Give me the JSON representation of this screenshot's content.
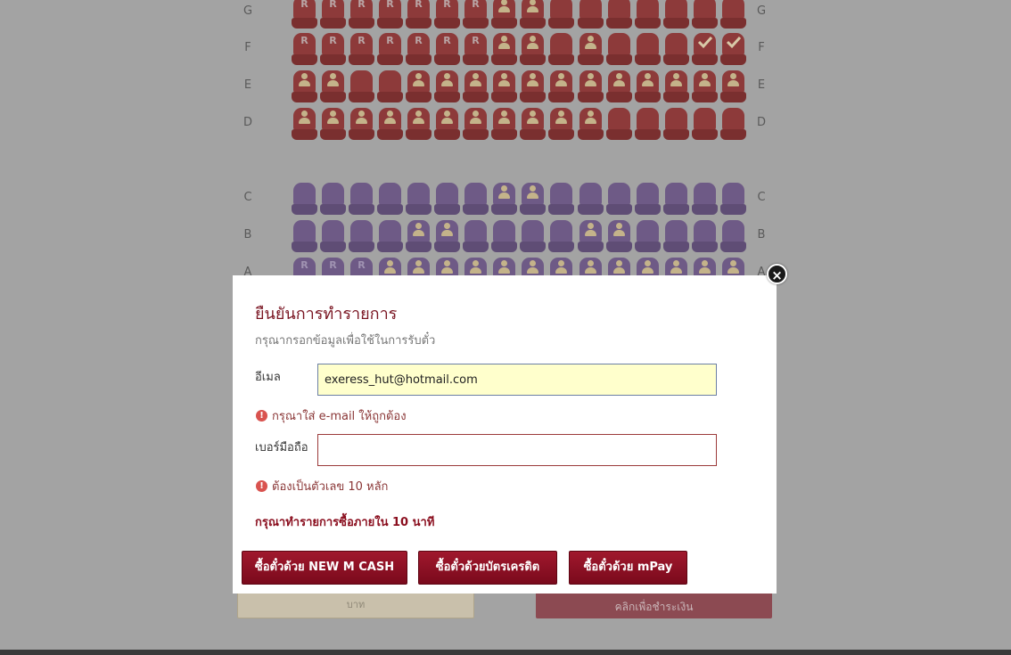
{
  "seat_map": {
    "rows_top": [
      {
        "letter": "G",
        "seats": [
          "R",
          "R",
          "R",
          "R",
          "R",
          "R",
          "R",
          "P",
          "P",
          "",
          "",
          "",
          "",
          "",
          "",
          ""
        ]
      },
      {
        "letter": "F",
        "seats": [
          "R",
          "R",
          "R",
          "R",
          "R",
          "R",
          "R",
          "P",
          "P",
          "",
          "P",
          "",
          "",
          "",
          "C",
          "C"
        ]
      },
      {
        "letter": "E",
        "seats": [
          "P",
          "P",
          "",
          "",
          "P",
          "P",
          "P",
          "P",
          "P",
          "P",
          "P",
          "P",
          "P",
          "P",
          "P",
          "P"
        ]
      },
      {
        "letter": "D",
        "seats": [
          "P",
          "P",
          "P",
          "P",
          "P",
          "P",
          "P",
          "P",
          "P",
          "P",
          "P",
          "",
          "",
          "",
          "",
          ""
        ]
      }
    ],
    "rows_bottom": [
      {
        "letter": "C",
        "seats": [
          "",
          "",
          "",
          "",
          "",
          "",
          "",
          "P",
          "P",
          "",
          "",
          "",
          "",
          "",
          "",
          ""
        ]
      },
      {
        "letter": "B",
        "seats": [
          "",
          "",
          "",
          "",
          "P",
          "P",
          "",
          "",
          "",
          "",
          "P",
          "P",
          "",
          "",
          "",
          ""
        ]
      },
      {
        "letter": "A",
        "seats": [
          "R",
          "R",
          "R",
          "P",
          "P",
          "P",
          "P",
          "P",
          "P",
          "P",
          "P",
          "P",
          "P",
          "P",
          "P",
          "P"
        ]
      }
    ]
  },
  "background_controls": {
    "amount_unit": "บาท",
    "pay_button": "คลิกเพื่อชำระเงิน"
  },
  "modal": {
    "close_symbol": "×",
    "title": "ยืนยันการทำรายการ",
    "subtitle": "กรุณากรอกข้อมูลเพื่อใช้ในการรับตั๋ว",
    "email_label": "อีเมล",
    "email_value": "exeress_hut@hotmail.com",
    "email_error": "กรุณาใส่ e-mail ให้ถูกต้อง",
    "phone_label": "เบอร์มือถือ",
    "phone_value": "",
    "phone_error": "ต้องเป็นตัวเลข 10 หลัก",
    "error_icon": "!",
    "deadline_note": "กรุณาทำรายการซื้อภายใน 10 นาที",
    "buttons": {
      "mcash": "ซื้อตั๋วด้วย NEW M CASH",
      "credit": "ซื้อตั๋วด้วยบัตรเครดิต",
      "mpay": "ซื้อตั๋วด้วย mPay"
    }
  }
}
